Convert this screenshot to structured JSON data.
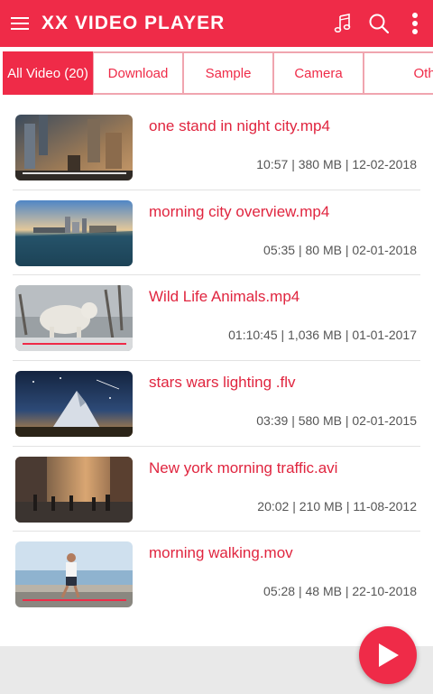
{
  "app_bar": {
    "title": "XX VIDEO PLAYER",
    "icons": [
      "hamburger-menu-icon",
      "music-icon",
      "search-icon",
      "more-vert-icon"
    ],
    "color": "#ef2b48"
  },
  "tabs": [
    {
      "label": "All Video (20)",
      "active": true
    },
    {
      "label": "Download",
      "active": false
    },
    {
      "label": "Sample",
      "active": false
    },
    {
      "label": "Camera",
      "active": false
    },
    {
      "label": "Other",
      "active": false
    }
  ],
  "videos": [
    {
      "title": "one stand in night city.mp4",
      "meta": "10:57  | 380 MB | 12-02-2018"
    },
    {
      "title": "morning city overview.mp4",
      "meta": "05:35  | 80 MB | 02-01-2018"
    },
    {
      "title": "Wild Life Animals.mp4",
      "meta": "01:10:45  | 1,036 MB | 01-01-2017"
    },
    {
      "title": "stars wars lighting .flv",
      "meta": "03:39  | 580 MB | 02-01-2015"
    },
    {
      "title": "New york morning traffic.avi",
      "meta": "20:02  | 210 MB | 11-08-2012"
    },
    {
      "title": "morning walking.mov",
      "meta": "05:28  | 48 MB | 22-10-2018"
    }
  ],
  "fab": {
    "icon": "play-icon"
  }
}
